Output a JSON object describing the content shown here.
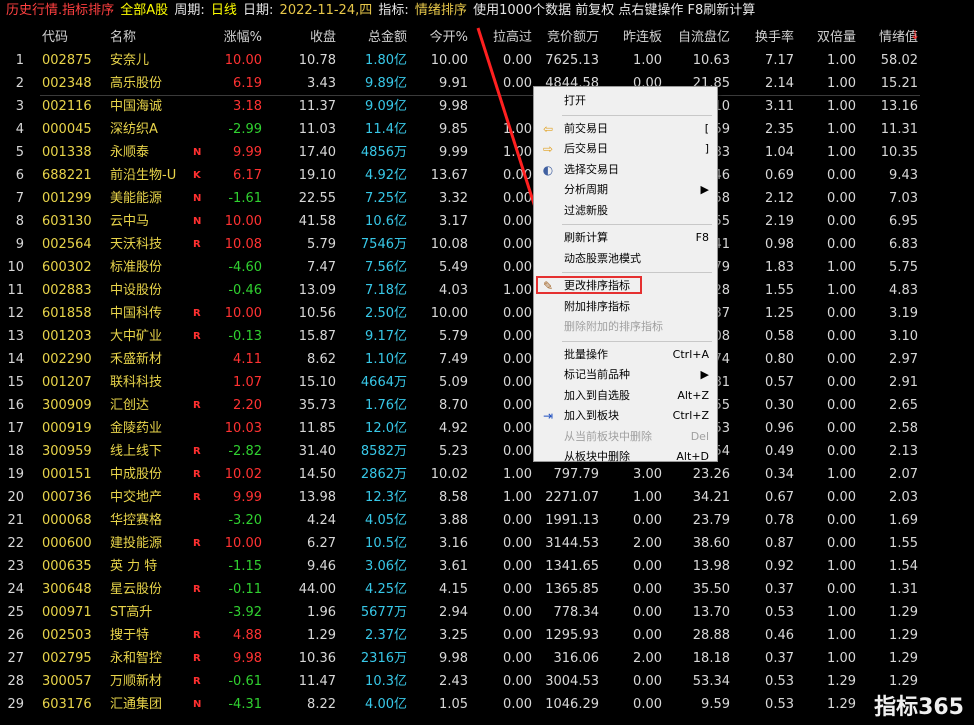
{
  "titlebar": {
    "mode": "历史行情.指标排序",
    "scope": "全部A股",
    "period_label": "周期:",
    "period_value": "日线",
    "date_label": "日期:",
    "date_value": "2022-11-24,四",
    "indicator_label": "指标:",
    "indicator_value": "情绪排序",
    "note": "使用1000个数据 前复权 点右键操作 F8刷新计算"
  },
  "columns": [
    "代码",
    "名称",
    "涨幅%",
    "收盘",
    "总金额",
    "今开%",
    "拉高过",
    "竞价额万",
    "昨连板",
    "自流盘亿",
    "换手率",
    "双倍量",
    "情绪值"
  ],
  "sort_arrow": "↓",
  "rows": [
    {
      "idx": "1",
      "code": "002875",
      "name": "安奈儿",
      "flag": "",
      "chg": "10.00",
      "close": "10.78",
      "amt": "1.80亿",
      "open": "10.00",
      "pull": "0.00",
      "bid": "7625.13",
      "board": "1.00",
      "float": "10.63",
      "turn": "7.17",
      "dbl": "1.00",
      "emo": "58.02"
    },
    {
      "idx": "2",
      "code": "002348",
      "name": "高乐股份",
      "flag": "",
      "chg": "6.19",
      "close": "3.43",
      "amt": "9.89亿",
      "open": "9.91",
      "pull": "0.00",
      "bid": "4844.58",
      "board": "0.00",
      "float": "21.85",
      "turn": "2.14",
      "dbl": "1.00",
      "emo": "15.21"
    },
    {
      "idx": "3",
      "code": "002116",
      "name": "中国海诚",
      "flag": "",
      "chg": "3.18",
      "close": "11.37",
      "amt": "9.09亿",
      "open": "9.98",
      "pull": "",
      "bid": "",
      "board": "",
      "float": "10",
      "turn": "3.11",
      "dbl": "1.00",
      "emo": "13.16"
    },
    {
      "idx": "4",
      "code": "000045",
      "name": "深纺织A",
      "flag": "",
      "chg": "-2.99",
      "close": "11.03",
      "amt": "11.4亿",
      "open": "9.85",
      "pull": "1.00",
      "bid": "",
      "board": "",
      "float": "59",
      "turn": "2.35",
      "dbl": "1.00",
      "emo": "11.31"
    },
    {
      "idx": "5",
      "code": "001338",
      "name": "永顺泰",
      "flag": "N",
      "chg": "9.99",
      "close": "17.40",
      "amt": "4856万",
      "open": "9.99",
      "pull": "1.00",
      "bid": "",
      "board": "",
      "float": "83",
      "turn": "1.04",
      "dbl": "1.00",
      "emo": "10.35"
    },
    {
      "idx": "6",
      "code": "688221",
      "name": "前沿生物-U",
      "flag": "K",
      "chg": "6.17",
      "close": "19.10",
      "amt": "4.92亿",
      "open": "13.67",
      "pull": "0.00",
      "bid": "",
      "board": "",
      "float": "46",
      "turn": "0.69",
      "dbl": "0.00",
      "emo": "9.43"
    },
    {
      "idx": "7",
      "code": "001299",
      "name": "美能能源",
      "flag": "N",
      "chg": "-1.61",
      "close": "22.55",
      "amt": "7.25亿",
      "open": "3.32",
      "pull": "0.00",
      "bid": "",
      "board": "",
      "float": "58",
      "turn": "2.12",
      "dbl": "0.00",
      "emo": "7.03"
    },
    {
      "idx": "8",
      "code": "603130",
      "name": "云中马",
      "flag": "N",
      "chg": "10.00",
      "close": "41.58",
      "amt": "10.6亿",
      "open": "3.17",
      "pull": "0.00",
      "bid": "",
      "board": "",
      "float": "55",
      "turn": "2.19",
      "dbl": "0.00",
      "emo": "6.95"
    },
    {
      "idx": "9",
      "code": "002564",
      "name": "天沃科技",
      "flag": "R",
      "chg": "10.08",
      "close": "5.79",
      "amt": "7546万",
      "open": "10.08",
      "pull": "0.00",
      "bid": "",
      "board": "",
      "float": "41",
      "turn": "0.98",
      "dbl": "0.00",
      "emo": "6.83"
    },
    {
      "idx": "10",
      "code": "600302",
      "name": "标准股份",
      "flag": "",
      "chg": "-4.60",
      "close": "7.47",
      "amt": "7.56亿",
      "open": "5.49",
      "pull": "0.00",
      "bid": "",
      "board": "",
      "float": "79",
      "turn": "1.83",
      "dbl": "1.00",
      "emo": "5.75"
    },
    {
      "idx": "11",
      "code": "002883",
      "name": "中设股份",
      "flag": "",
      "chg": "-0.46",
      "close": "13.09",
      "amt": "7.18亿",
      "open": "4.03",
      "pull": "1.00",
      "bid": "",
      "board": "",
      "float": "28",
      "turn": "1.55",
      "dbl": "1.00",
      "emo": "4.83"
    },
    {
      "idx": "12",
      "code": "601858",
      "name": "中国科传",
      "flag": "R",
      "chg": "10.00",
      "close": "10.56",
      "amt": "2.50亿",
      "open": "10.00",
      "pull": "0.00",
      "bid": "",
      "board": "",
      "float": "37",
      "turn": "1.25",
      "dbl": "0.00",
      "emo": "3.19"
    },
    {
      "idx": "13",
      "code": "001203",
      "name": "大中矿业",
      "flag": "R",
      "chg": "-0.13",
      "close": "15.87",
      "amt": "9.17亿",
      "open": "5.79",
      "pull": "0.00",
      "bid": "",
      "board": "",
      "float": "08",
      "turn": "0.58",
      "dbl": "0.00",
      "emo": "3.10"
    },
    {
      "idx": "14",
      "code": "002290",
      "name": "禾盛新材",
      "flag": "",
      "chg": "4.11",
      "close": "8.62",
      "amt": "1.10亿",
      "open": "7.49",
      "pull": "0.00",
      "bid": "",
      "board": "",
      "float": "74",
      "turn": "0.80",
      "dbl": "0.00",
      "emo": "2.97"
    },
    {
      "idx": "15",
      "code": "001207",
      "name": "联科科技",
      "flag": "",
      "chg": "1.07",
      "close": "15.10",
      "amt": "4664万",
      "open": "5.09",
      "pull": "0.00",
      "bid": "",
      "board": "",
      "float": "81",
      "turn": "0.57",
      "dbl": "0.00",
      "emo": "2.91"
    },
    {
      "idx": "16",
      "code": "300909",
      "name": "汇创达",
      "flag": "R",
      "chg": "2.20",
      "close": "35.73",
      "amt": "1.76亿",
      "open": "8.70",
      "pull": "0.00",
      "bid": "",
      "board": "",
      "float": "55",
      "turn": "0.30",
      "dbl": "0.00",
      "emo": "2.65"
    },
    {
      "idx": "17",
      "code": "000919",
      "name": "金陵药业",
      "flag": "",
      "chg": "10.03",
      "close": "11.85",
      "amt": "12.0亿",
      "open": "4.92",
      "pull": "0.00",
      "bid": "",
      "board": "",
      "float": "53",
      "turn": "0.96",
      "dbl": "0.00",
      "emo": "2.58"
    },
    {
      "idx": "18",
      "code": "300959",
      "name": "线上线下",
      "flag": "R",
      "chg": "-2.82",
      "close": "31.40",
      "amt": "8582万",
      "open": "5.23",
      "pull": "0.00",
      "bid": "",
      "board": "",
      "float": "54",
      "turn": "0.49",
      "dbl": "0.00",
      "emo": "2.13"
    },
    {
      "idx": "19",
      "code": "000151",
      "name": "中成股份",
      "flag": "R",
      "chg": "10.02",
      "close": "14.50",
      "amt": "2862万",
      "open": "10.02",
      "pull": "1.00",
      "bid": "797.79",
      "board": "3.00",
      "float": "23.26",
      "turn": "0.34",
      "dbl": "1.00",
      "emo": "2.07"
    },
    {
      "idx": "20",
      "code": "000736",
      "name": "中交地产",
      "flag": "R",
      "chg": "9.99",
      "close": "13.98",
      "amt": "12.3亿",
      "open": "8.58",
      "pull": "1.00",
      "bid": "2271.07",
      "board": "1.00",
      "float": "34.21",
      "turn": "0.67",
      "dbl": "0.00",
      "emo": "2.03"
    },
    {
      "idx": "21",
      "code": "000068",
      "name": "华控赛格",
      "flag": "",
      "chg": "-3.20",
      "close": "4.24",
      "amt": "4.05亿",
      "open": "3.88",
      "pull": "0.00",
      "bid": "1991.13",
      "board": "0.00",
      "float": "23.79",
      "turn": "0.78",
      "dbl": "0.00",
      "emo": "1.69"
    },
    {
      "idx": "22",
      "code": "000600",
      "name": "建投能源",
      "flag": "R",
      "chg": "10.00",
      "close": "6.27",
      "amt": "10.5亿",
      "open": "3.16",
      "pull": "0.00",
      "bid": "3144.53",
      "board": "2.00",
      "float": "38.60",
      "turn": "0.87",
      "dbl": "0.00",
      "emo": "1.55"
    },
    {
      "idx": "23",
      "code": "000635",
      "name": "英 力 特",
      "flag": "",
      "chg": "-1.15",
      "close": "9.46",
      "amt": "3.06亿",
      "open": "3.61",
      "pull": "0.00",
      "bid": "1341.65",
      "board": "0.00",
      "float": "13.98",
      "turn": "0.92",
      "dbl": "1.00",
      "emo": "1.54"
    },
    {
      "idx": "24",
      "code": "300648",
      "name": "星云股份",
      "flag": "R",
      "chg": "-0.11",
      "close": "44.00",
      "amt": "4.25亿",
      "open": "4.15",
      "pull": "0.00",
      "bid": "1365.85",
      "board": "0.00",
      "float": "35.50",
      "turn": "0.37",
      "dbl": "0.00",
      "emo": "1.31"
    },
    {
      "idx": "25",
      "code": "000971",
      "name": "ST高升",
      "flag": "",
      "chg": "-3.92",
      "close": "1.96",
      "amt": "5677万",
      "open": "2.94",
      "pull": "0.00",
      "bid": "778.34",
      "board": "0.00",
      "float": "13.70",
      "turn": "0.53",
      "dbl": "1.00",
      "emo": "1.29"
    },
    {
      "idx": "26",
      "code": "002503",
      "name": "搜于特",
      "flag": "R",
      "chg": "4.88",
      "close": "1.29",
      "amt": "2.37亿",
      "open": "3.25",
      "pull": "0.00",
      "bid": "1295.93",
      "board": "0.00",
      "float": "28.88",
      "turn": "0.46",
      "dbl": "1.00",
      "emo": "1.29"
    },
    {
      "idx": "27",
      "code": "002795",
      "name": "永和智控",
      "flag": "R",
      "chg": "9.98",
      "close": "10.36",
      "amt": "2316万",
      "open": "9.98",
      "pull": "0.00",
      "bid": "316.06",
      "board": "2.00",
      "float": "18.18",
      "turn": "0.37",
      "dbl": "1.00",
      "emo": "1.29"
    },
    {
      "idx": "28",
      "code": "300057",
      "name": "万顺新材",
      "flag": "R",
      "chg": "-0.61",
      "close": "11.47",
      "amt": "10.3亿",
      "open": "2.43",
      "pull": "0.00",
      "bid": "3004.53",
      "board": "0.00",
      "float": "53.34",
      "turn": "0.53",
      "dbl": "1.29",
      "emo": "1.29"
    },
    {
      "idx": "29",
      "code": "603176",
      "name": "汇通集团",
      "flag": "N",
      "chg": "-4.31",
      "close": "8.22",
      "amt": "4.00亿",
      "open": "1.05",
      "pull": "0.00",
      "bid": "1046.29",
      "board": "0.00",
      "float": "9.59",
      "turn": "0.53",
      "dbl": "1.29",
      "emo": ""
    }
  ],
  "menu": [
    {
      "label": "打开",
      "shortcut": "",
      "icon": "",
      "disabled": false
    },
    {
      "sep": true
    },
    {
      "label": "前交易日",
      "shortcut": "[",
      "icon": "arrow-left-icon",
      "disabled": false
    },
    {
      "label": "后交易日",
      "shortcut": "]",
      "icon": "arrow-right-icon",
      "disabled": false
    },
    {
      "label": "选择交易日",
      "shortcut": "",
      "icon": "calendar-icon",
      "disabled": false
    },
    {
      "label": "分析周期",
      "shortcut": "▶",
      "icon": "",
      "disabled": false
    },
    {
      "label": "过滤新股",
      "shortcut": "",
      "icon": "",
      "disabled": false
    },
    {
      "sep": true
    },
    {
      "label": "刷新计算",
      "shortcut": "F8",
      "icon": "",
      "disabled": false
    },
    {
      "label": "动态股票池模式",
      "shortcut": "",
      "icon": "",
      "disabled": false
    },
    {
      "sep": true
    },
    {
      "label": "更改排序指标",
      "shortcut": "",
      "icon": "indicator-icon",
      "disabled": false,
      "highlight": true
    },
    {
      "label": "附加排序指标",
      "shortcut": "",
      "icon": "",
      "disabled": false
    },
    {
      "label": "删除附加的排序指标",
      "shortcut": "",
      "icon": "",
      "disabled": true
    },
    {
      "sep": true
    },
    {
      "label": "批量操作",
      "shortcut": "Ctrl+A",
      "icon": "",
      "disabled": false
    },
    {
      "label": "标记当前品种",
      "shortcut": "▶",
      "icon": "",
      "disabled": false
    },
    {
      "label": "加入到自选股",
      "shortcut": "Alt+Z",
      "icon": "",
      "disabled": false
    },
    {
      "label": "加入到板块",
      "shortcut": "Ctrl+Z",
      "icon": "add-to-block-icon",
      "disabled": false
    },
    {
      "label": "从当前板块中删除",
      "shortcut": "Del",
      "icon": "",
      "disabled": true
    },
    {
      "label": "从板块中删除",
      "shortcut": "Alt+D",
      "icon": "",
      "disabled": false
    }
  ],
  "watermark": "指标365",
  "colors": {
    "up": "#ff3232",
    "down": "#30d030",
    "code": "#e8d44a",
    "amount": "#38c8e8",
    "menu_highlight": "#e53030"
  }
}
